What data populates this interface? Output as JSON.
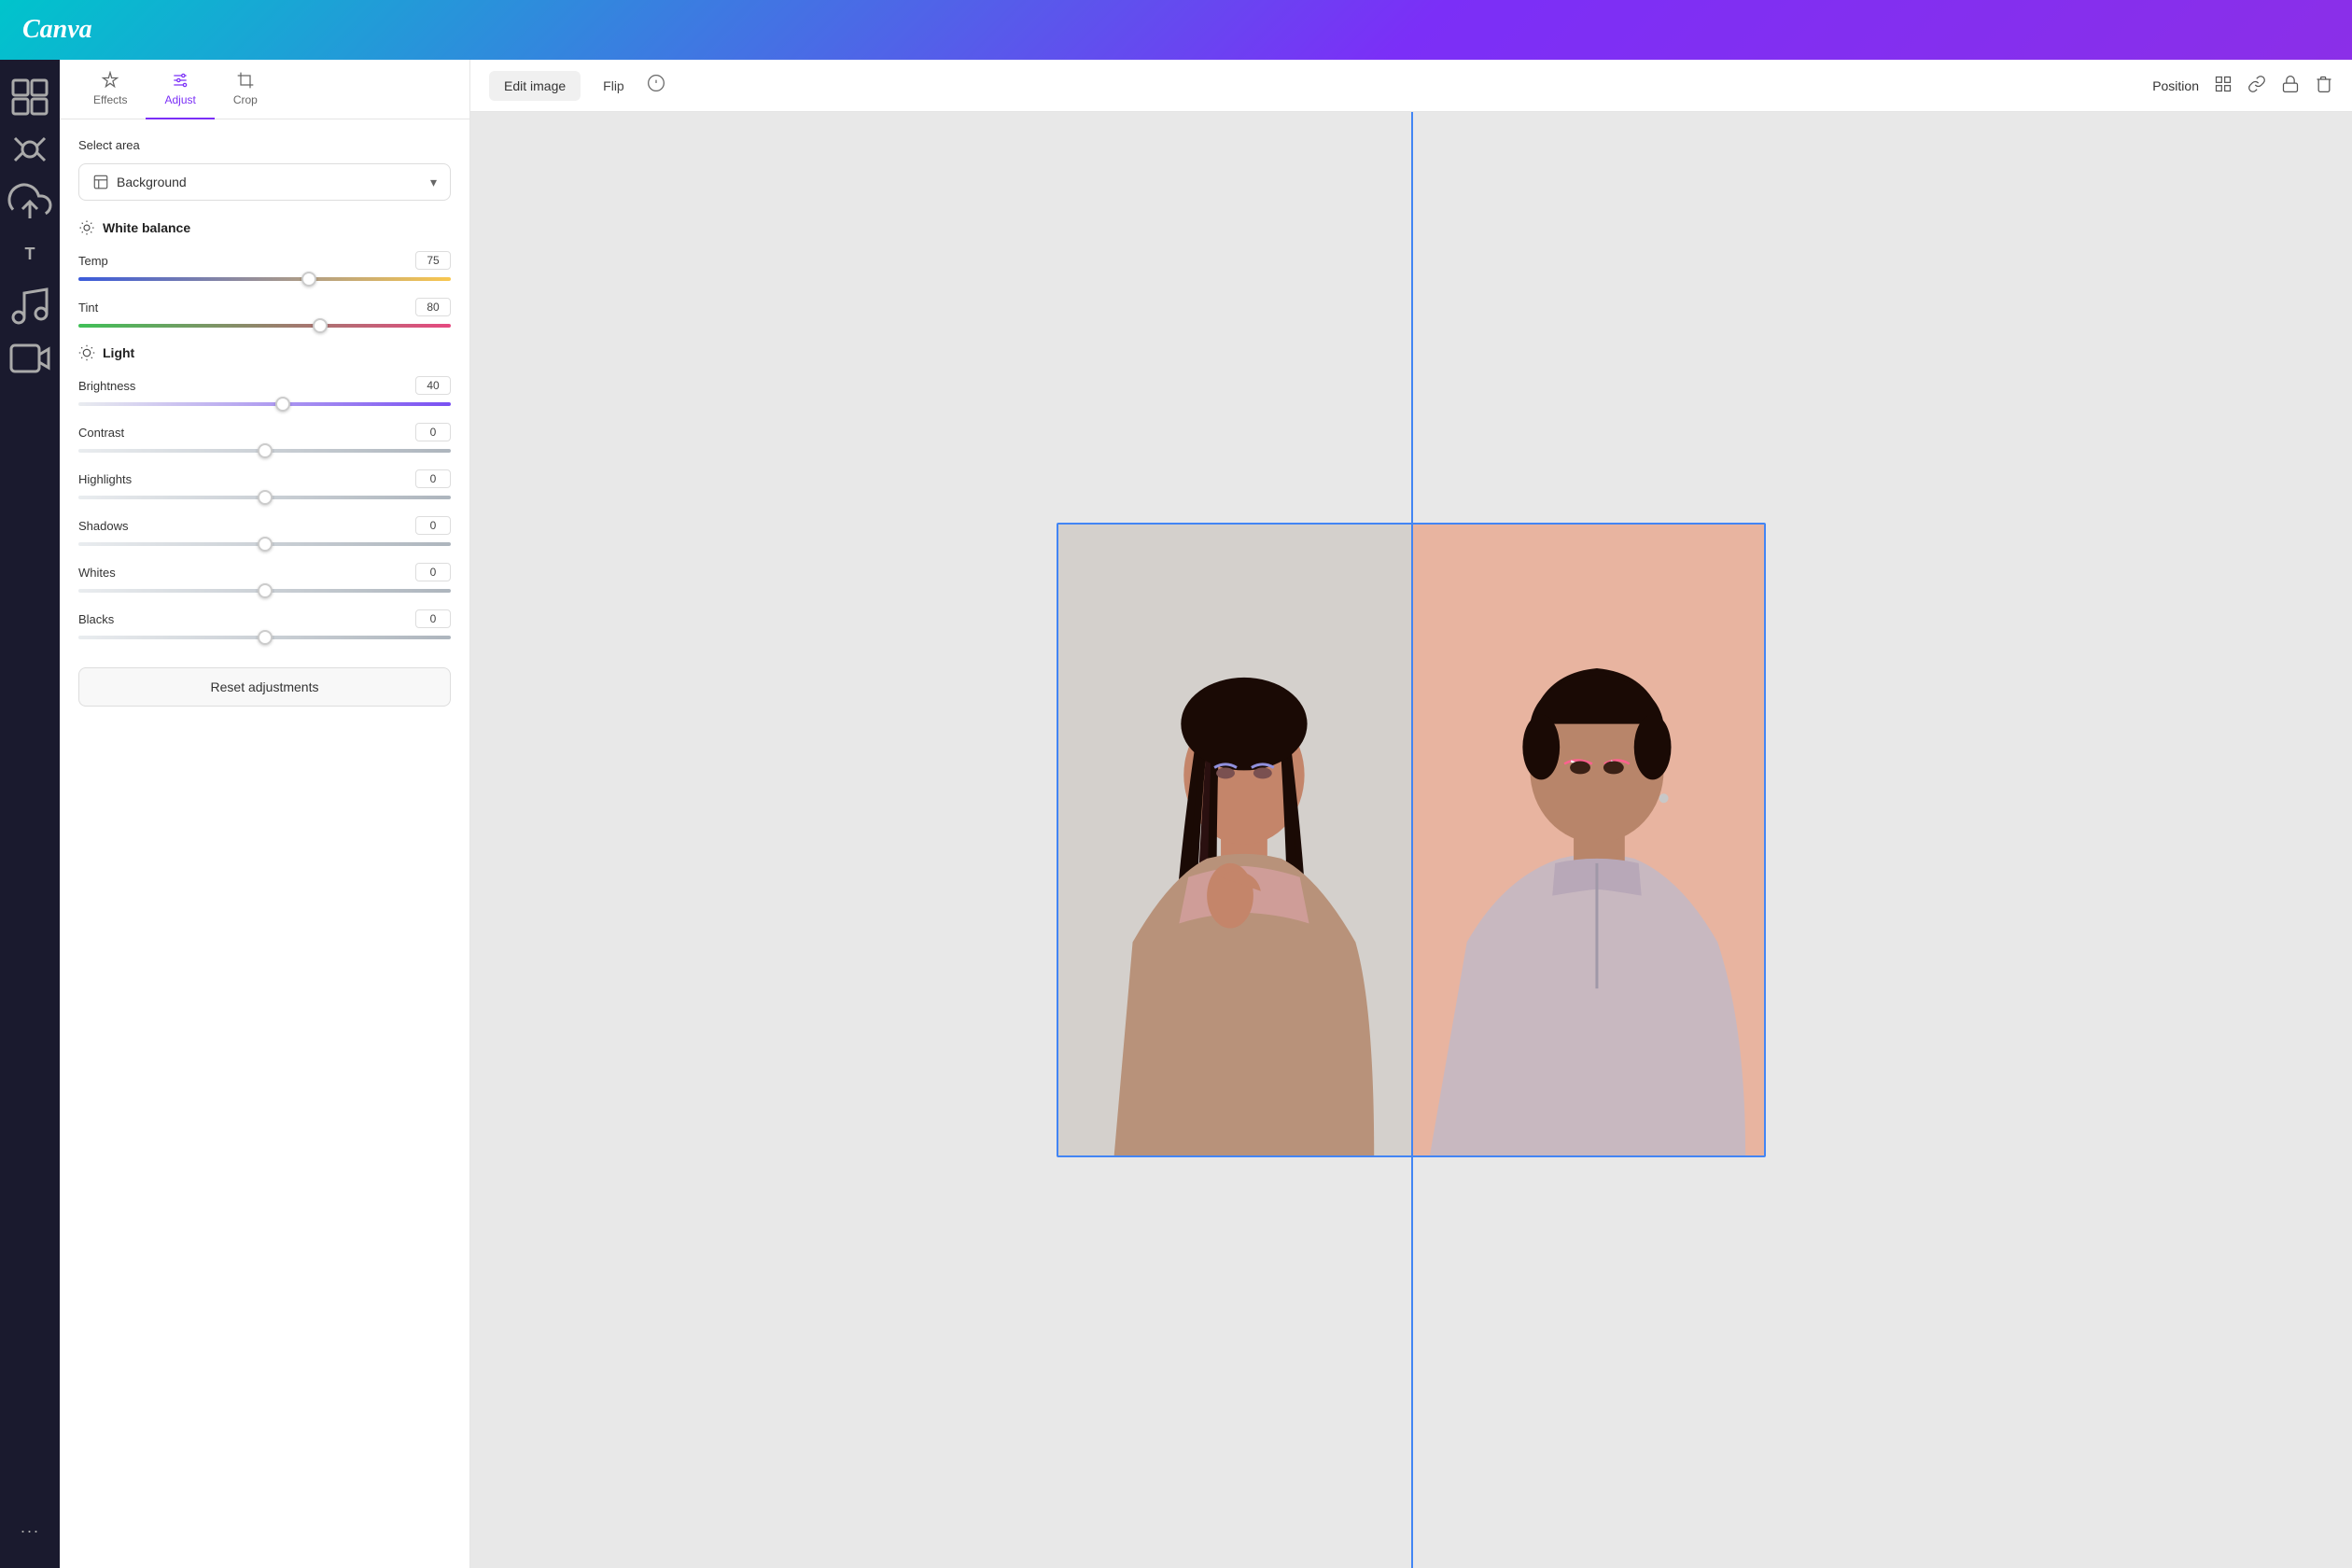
{
  "header": {
    "logo": "Canva"
  },
  "toolbar": {
    "edit_image_label": "Edit image",
    "flip_label": "Flip",
    "position_label": "Position"
  },
  "tabs": [
    {
      "id": "effects",
      "label": "Effects",
      "active": false
    },
    {
      "id": "adjust",
      "label": "Adjust",
      "active": true
    },
    {
      "id": "crop",
      "label": "Crop",
      "active": false
    }
  ],
  "panel": {
    "select_area_label": "Select area",
    "background_option": "Background",
    "white_balance_label": "White balance",
    "light_label": "Light",
    "temp_label": "Temp",
    "temp_value": "75",
    "temp_percent": 62,
    "tint_label": "Tint",
    "tint_value": "80",
    "tint_percent": 65,
    "brightness_label": "Brightness",
    "brightness_value": "40",
    "brightness_percent": 55,
    "contrast_label": "Contrast",
    "contrast_value": "0",
    "contrast_percent": 50,
    "highlights_label": "Highlights",
    "highlights_value": "0",
    "highlights_percent": 50,
    "shadows_label": "Shadows",
    "shadows_value": "0",
    "shadows_percent": 50,
    "whites_label": "Whites",
    "whites_value": "0",
    "whites_percent": 50,
    "blacks_label": "Blacks",
    "blacks_value": "0",
    "blacks_percent": 50,
    "reset_label": "Reset adjustments"
  },
  "icons": {
    "layout": "⊞",
    "elements": "◈",
    "upload": "↑",
    "text": "T",
    "music": "♪",
    "video": "▶",
    "more": "···",
    "info": "ⓘ",
    "grid": "⊞",
    "link": "⛓",
    "lock": "🔒",
    "trash": "🗑"
  }
}
